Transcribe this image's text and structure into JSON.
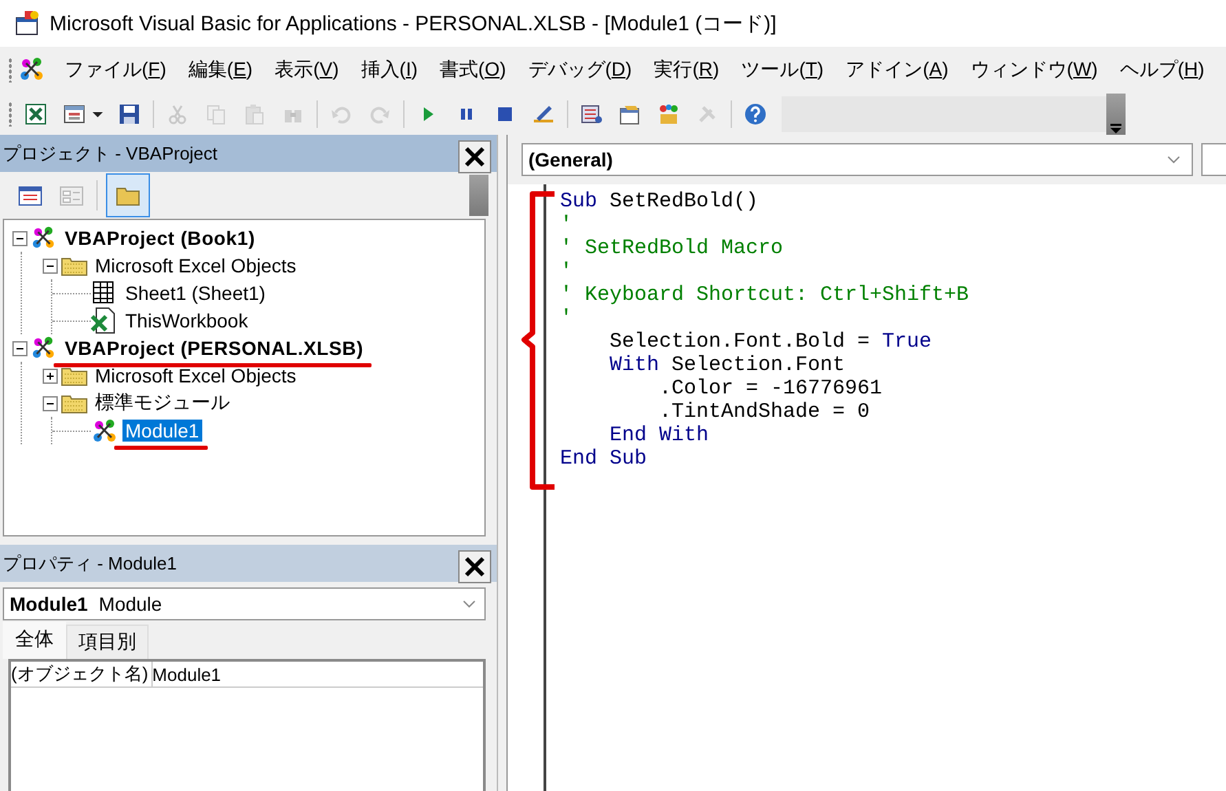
{
  "window": {
    "title": "Microsoft Visual Basic for Applications - PERSONAL.XLSB - [Module1 (コード)]"
  },
  "menu": [
    {
      "text": "ファイル(",
      "accel": "F",
      "after": ")"
    },
    {
      "text": "編集(",
      "accel": "E",
      "after": ")"
    },
    {
      "text": "表示(",
      "accel": "V",
      "after": ")"
    },
    {
      "text": "挿入(",
      "accel": "I",
      "after": ")"
    },
    {
      "text": "書式(",
      "accel": "O",
      "after": ")"
    },
    {
      "text": "デバッグ(",
      "accel": "D",
      "after": ")"
    },
    {
      "text": "実行(",
      "accel": "R",
      "after": ")"
    },
    {
      "text": "ツール(",
      "accel": "T",
      "after": ")"
    },
    {
      "text": "アドイン(",
      "accel": "A",
      "after": ")"
    },
    {
      "text": "ウィンドウ(",
      "accel": "W",
      "after": ")"
    },
    {
      "text": "ヘルプ(",
      "accel": "H",
      "after": ")"
    }
  ],
  "toolbar": [
    {
      "kind": "excel",
      "disabled": false
    },
    {
      "kind": "insert-form",
      "disabled": false
    },
    {
      "kind": "dropdown",
      "disabled": false
    },
    {
      "kind": "save",
      "disabled": false
    },
    {
      "kind": "separator"
    },
    {
      "kind": "cut",
      "disabled": true
    },
    {
      "kind": "copy",
      "disabled": true
    },
    {
      "kind": "paste",
      "disabled": true
    },
    {
      "kind": "find",
      "disabled": true
    },
    {
      "kind": "separator"
    },
    {
      "kind": "undo",
      "disabled": true
    },
    {
      "kind": "redo",
      "disabled": true
    },
    {
      "kind": "separator"
    },
    {
      "kind": "run",
      "disabled": false
    },
    {
      "kind": "pause",
      "disabled": false
    },
    {
      "kind": "stop",
      "disabled": false
    },
    {
      "kind": "design",
      "disabled": false
    },
    {
      "kind": "separator"
    },
    {
      "kind": "project",
      "disabled": false
    },
    {
      "kind": "properties",
      "disabled": false
    },
    {
      "kind": "object-browser",
      "disabled": false
    },
    {
      "kind": "toolbox",
      "disabled": true
    },
    {
      "kind": "separator"
    },
    {
      "kind": "help",
      "disabled": false
    }
  ],
  "project": {
    "title": "プロジェクト - VBAProject",
    "buttons": [
      {
        "kind": "view-code",
        "selected": false,
        "disabled": false
      },
      {
        "kind": "view-object",
        "selected": false,
        "disabled": true
      },
      {
        "kind": "toggle-folders",
        "selected": true,
        "disabled": false
      }
    ],
    "tree": [
      {
        "label": "VBAProject (Book1)",
        "kind": "project",
        "expanded": true,
        "selected": false,
        "underlined": false,
        "children": [
          {
            "label": "Microsoft Excel Objects",
            "kind": "folder",
            "expanded": true,
            "selected": false,
            "underlined": false,
            "children": [
              {
                "label": "Sheet1 (Sheet1)",
                "kind": "sheet",
                "selected": false,
                "underlined": false
              },
              {
                "label": "ThisWorkbook",
                "kind": "workbook",
                "selected": false,
                "underlined": false
              }
            ]
          }
        ]
      },
      {
        "label": "VBAProject (PERSONAL.XLSB)",
        "kind": "project",
        "expanded": true,
        "selected": false,
        "underlined": true,
        "children": [
          {
            "label": "Microsoft Excel Objects",
            "kind": "folder",
            "expanded": false,
            "selected": false,
            "underlined": false
          },
          {
            "label": "標準モジュール",
            "kind": "folder",
            "expanded": true,
            "selected": false,
            "underlined": false,
            "children": [
              {
                "label": "Module1",
                "kind": "module",
                "selected": true,
                "underlined": true
              }
            ]
          }
        ]
      }
    ]
  },
  "properties": {
    "title": "プロパティ - Module1",
    "object_name": "Module1",
    "object_type": "Module",
    "tabs": [
      {
        "label": "全体",
        "selected": true
      },
      {
        "label": "項目別",
        "selected": false
      }
    ],
    "rows": [
      {
        "name": "(オブジェクト名)",
        "value": "Module1"
      }
    ]
  },
  "code": {
    "object_dropdown": "(General)",
    "lines": [
      [
        {
          "kind": "keyword",
          "text": "Sub"
        },
        {
          "kind": "plain",
          "text": " SetRedBold()"
        }
      ],
      [
        {
          "kind": "comment",
          "text": "'"
        }
      ],
      [
        {
          "kind": "comment",
          "text": "' SetRedBold Macro"
        }
      ],
      [
        {
          "kind": "comment",
          "text": "'"
        }
      ],
      [
        {
          "kind": "comment",
          "text": "' Keyboard Shortcut: Ctrl+Shift+B"
        }
      ],
      [
        {
          "kind": "comment",
          "text": "'"
        }
      ],
      [
        {
          "kind": "plain",
          "text": "    Selection.Font.Bold = "
        },
        {
          "kind": "keyword",
          "text": "True"
        }
      ],
      [
        {
          "kind": "keyword",
          "text": "    With"
        },
        {
          "kind": "plain",
          "text": " Selection.Font"
        }
      ],
      [
        {
          "kind": "plain",
          "text": "        .Color = -16776961"
        }
      ],
      [
        {
          "kind": "plain",
          "text": "        .TintAndShade = 0"
        }
      ],
      [
        {
          "kind": "keyword",
          "text": "    End With"
        }
      ],
      [
        {
          "kind": "keyword",
          "text": "End Sub"
        }
      ]
    ]
  }
}
